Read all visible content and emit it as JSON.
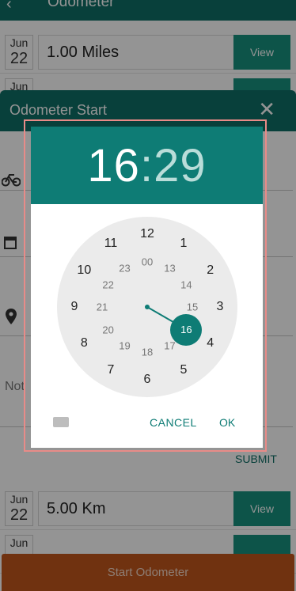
{
  "app_bar": {
    "back_glyph": "‹",
    "title": "Odometer"
  },
  "trips": [
    {
      "month": "Jun",
      "day": "22",
      "value": "1.00 Miles",
      "view_label": "View"
    },
    {
      "month": "Jun",
      "day": "",
      "value": "",
      "view_label": ""
    },
    {
      "month": "Jun",
      "day": "22",
      "value": "5.00 Km",
      "view_label": "View"
    },
    {
      "month": "Jun",
      "day": "",
      "value": "",
      "view_label": ""
    }
  ],
  "modal": {
    "title": "Odometer Start",
    "close_glyph": "✕",
    "notes_placeholder": "Not",
    "submit_label": "SUBMIT"
  },
  "time_picker": {
    "hour": "16",
    "minute": "29",
    "outer_numbers": [
      "12",
      "1",
      "2",
      "3",
      "4",
      "5",
      "6",
      "7",
      "8",
      "9",
      "10",
      "11"
    ],
    "inner_numbers": [
      "00",
      "13",
      "14",
      "15",
      "16",
      "17",
      "18",
      "19",
      "20",
      "21",
      "22",
      "23"
    ],
    "selected": "16",
    "cancel_label": "CANCEL",
    "ok_label": "OK"
  },
  "start_button_label": "Start Odometer",
  "colors": {
    "primary": "#0e6e66",
    "accent": "#18917f",
    "start": "#c2561c"
  }
}
